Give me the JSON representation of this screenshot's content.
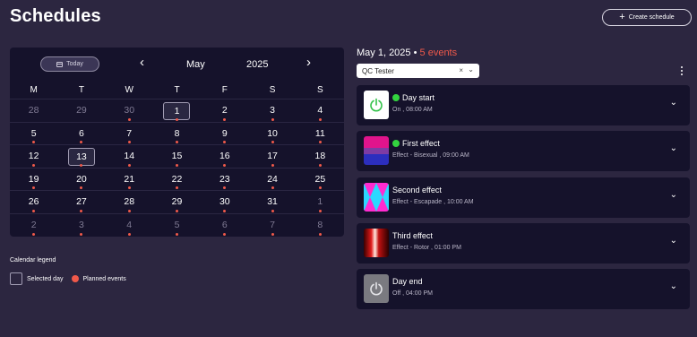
{
  "page": {
    "title": "Schedules",
    "create_label": "Create schedule"
  },
  "calendar": {
    "today_label": "Today",
    "month": "May",
    "year": "2025",
    "weekdays": [
      "M",
      "T",
      "W",
      "T",
      "F",
      "S",
      "S"
    ],
    "weeks": [
      [
        {
          "d": "28",
          "o": true,
          "e": false
        },
        {
          "d": "29",
          "o": true,
          "e": false
        },
        {
          "d": "30",
          "o": true,
          "e": true
        },
        {
          "d": "1",
          "o": false,
          "e": true,
          "s": true
        },
        {
          "d": "2",
          "o": false,
          "e": true
        },
        {
          "d": "3",
          "o": false,
          "e": true
        },
        {
          "d": "4",
          "o": false,
          "e": true
        }
      ],
      [
        {
          "d": "5",
          "o": false,
          "e": true
        },
        {
          "d": "6",
          "o": false,
          "e": true
        },
        {
          "d": "7",
          "o": false,
          "e": true
        },
        {
          "d": "8",
          "o": false,
          "e": true
        },
        {
          "d": "9",
          "o": false,
          "e": true
        },
        {
          "d": "10",
          "o": false,
          "e": true
        },
        {
          "d": "11",
          "o": false,
          "e": true
        }
      ],
      [
        {
          "d": "12",
          "o": false,
          "e": true
        },
        {
          "d": "13",
          "o": false,
          "e": true,
          "t": true
        },
        {
          "d": "14",
          "o": false,
          "e": true
        },
        {
          "d": "15",
          "o": false,
          "e": true
        },
        {
          "d": "16",
          "o": false,
          "e": true
        },
        {
          "d": "17",
          "o": false,
          "e": true
        },
        {
          "d": "18",
          "o": false,
          "e": true
        }
      ],
      [
        {
          "d": "19",
          "o": false,
          "e": true
        },
        {
          "d": "20",
          "o": false,
          "e": true
        },
        {
          "d": "21",
          "o": false,
          "e": true
        },
        {
          "d": "22",
          "o": false,
          "e": true
        },
        {
          "d": "23",
          "o": false,
          "e": true
        },
        {
          "d": "24",
          "o": false,
          "e": true
        },
        {
          "d": "25",
          "o": false,
          "e": true
        }
      ],
      [
        {
          "d": "26",
          "o": false,
          "e": true
        },
        {
          "d": "27",
          "o": false,
          "e": true
        },
        {
          "d": "28",
          "o": false,
          "e": true
        },
        {
          "d": "29",
          "o": false,
          "e": true
        },
        {
          "d": "30",
          "o": false,
          "e": true
        },
        {
          "d": "31",
          "o": false,
          "e": true
        },
        {
          "d": "1",
          "o": true,
          "e": true
        }
      ],
      [
        {
          "d": "2",
          "o": true,
          "e": true
        },
        {
          "d": "3",
          "o": true,
          "e": true
        },
        {
          "d": "4",
          "o": true,
          "e": true
        },
        {
          "d": "5",
          "o": true,
          "e": true
        },
        {
          "d": "6",
          "o": true,
          "e": true
        },
        {
          "d": "7",
          "o": true,
          "e": true
        },
        {
          "d": "8",
          "o": true,
          "e": true
        }
      ]
    ]
  },
  "legend": {
    "title": "Calendar legend",
    "selected": "Selected day",
    "planned": "Planned events"
  },
  "schedule": {
    "date": "May 1, 2025",
    "separator": "•",
    "events_count": "5 events",
    "device": "QC Tester",
    "clear": "×",
    "chevron": "⌄",
    "events": [
      {
        "title": "Day start",
        "sub": "On , 08:00 AM",
        "icon": "power-icon",
        "active": true
      },
      {
        "title": "First effect",
        "sub": "Effect - Bisexual , 09:00 AM",
        "icon": "bisexual-flag-thumbnail",
        "active": true
      },
      {
        "title": "Second effect",
        "sub": "Effect - Escapade , 10:00 AM",
        "icon": "escapade-thumbnail",
        "active": false
      },
      {
        "title": "Third effect",
        "sub": "Effect - Rotor , 01:00 PM",
        "icon": "rotor-thumbnail",
        "active": false
      },
      {
        "title": "Day end",
        "sub": "Off , 04:00 PM",
        "icon": "power-icon",
        "active": false
      }
    ]
  },
  "colors": {
    "bg": "#2c2640",
    "panel": "#15122b",
    "accent": "#f0594a",
    "active": "#33d43f"
  }
}
